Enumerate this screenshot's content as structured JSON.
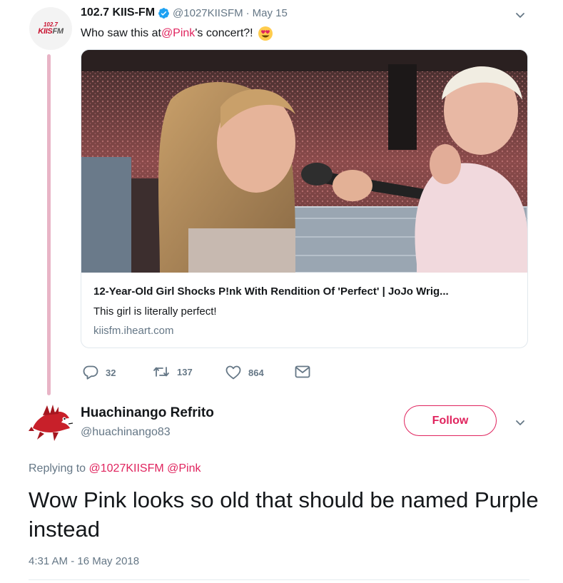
{
  "parent_tweet": {
    "display_name": "102.7 KIIS-FM",
    "handle": "@1027KIISFM",
    "separator": "·",
    "date": "May 15",
    "avatar": {
      "logo_small": "102.7",
      "logo_main_1": "KIIS",
      "logo_main_2": "FM"
    },
    "text_before": "Who saw this at ",
    "mention": "@Pink",
    "text_after": "'s concert?!",
    "emoji": "heart-eyes-emoji",
    "card": {
      "title": "12-Year-Old Girl Shocks P!nk With Rendition Of 'Perfect' | JoJo Wrig...",
      "description": "This girl is literally perfect!",
      "domain": "kiisfm.iheart.com"
    },
    "actions": {
      "replies": "32",
      "retweets": "137",
      "likes": "864"
    }
  },
  "reply_tweet": {
    "display_name": "Huachinango Refrito",
    "handle": "@huachinango83",
    "follow_label": "Follow",
    "replying_prefix": "Replying to ",
    "replying_mention_1": "@1027KIISFM",
    "replying_mention_2": "@Pink",
    "text": "Wow Pink looks so old that should be named Purple instead",
    "timestamp": "4:31 AM - 16 May 2018"
  },
  "colors": {
    "accent": "#e0245e",
    "muted": "#657786",
    "verified": "#1da1f2",
    "thread_line": "#e8b4c6"
  }
}
